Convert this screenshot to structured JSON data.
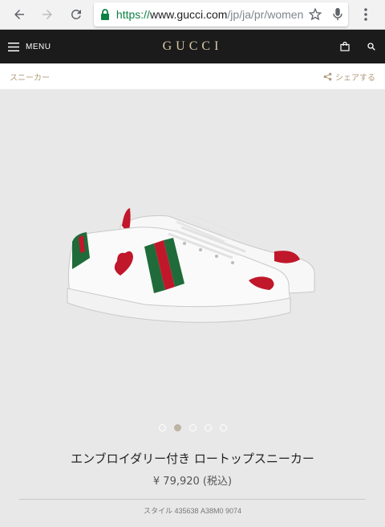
{
  "browser": {
    "url_scheme": "https://",
    "url_host": "www.gucci.com",
    "url_path": "/jp/ja/pr/women"
  },
  "header": {
    "menu_label": "MENU",
    "logo": "GUCCI"
  },
  "subbar": {
    "breadcrumb": "スニーカー",
    "share_label": "シェアする"
  },
  "gallery": {
    "image_count": 5,
    "active_index": 1
  },
  "product": {
    "name": "エンブロイダリー付き ロートップスニーカー",
    "price": "¥ 79,920 (税込)",
    "style": "スタイル 435638 A38M0 9074"
  },
  "colors": {
    "header_bg": "#1b1b1b",
    "accent_gold": "#b09b7a",
    "web_green": "#1f6b3a",
    "web_red": "#c0172a"
  }
}
